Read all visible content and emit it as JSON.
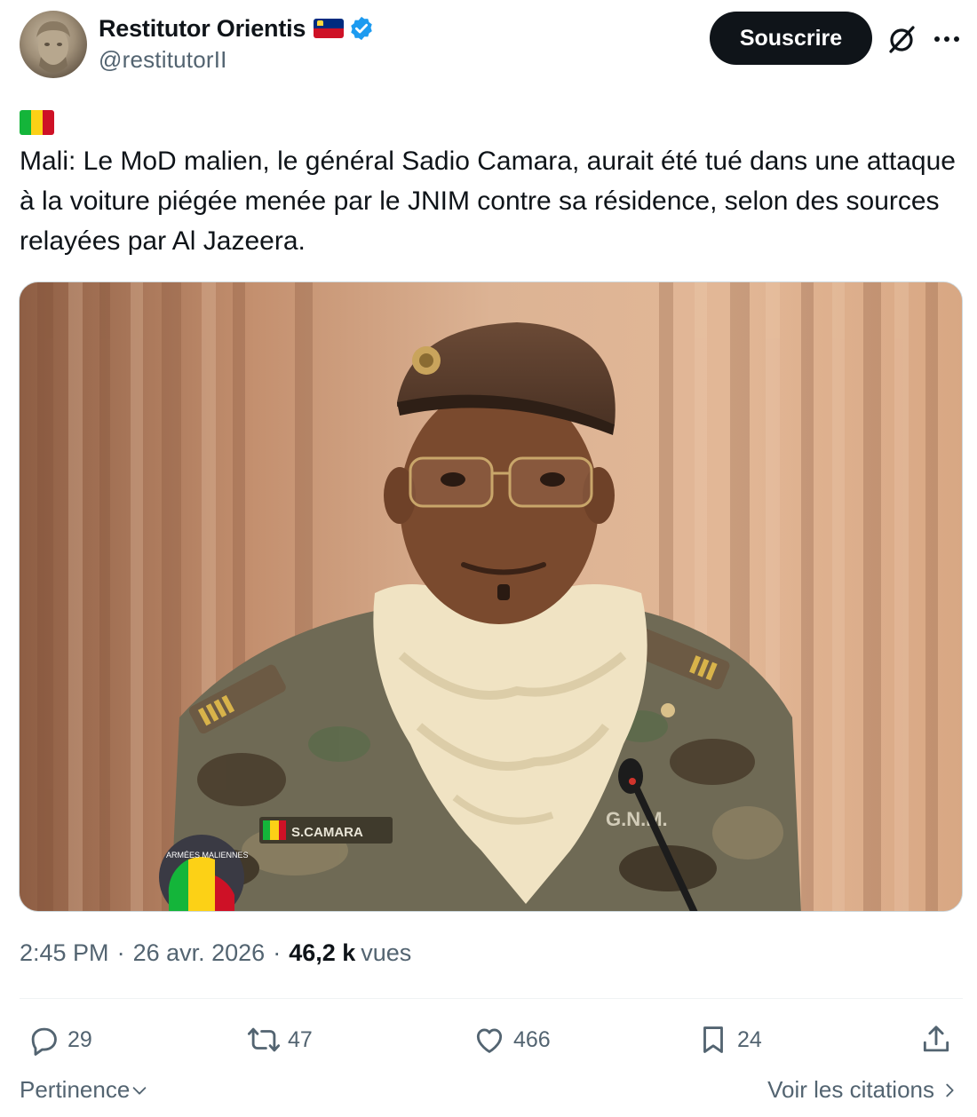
{
  "author": {
    "display_name": "Restitutor Orientis",
    "handle": "@restitutorII",
    "flag_icon": "liechtenstein-flag-icon",
    "verified_icon": "verified-badge-icon",
    "verified_color": "#1d9bf0"
  },
  "header": {
    "subscribe_label": "Souscrire",
    "grok_icon": "grok-icon",
    "more_icon": "more-icon"
  },
  "tweet": {
    "flag_icon": "mali-flag-icon",
    "text": "Mali: Le MoD malien, le général Sadio Camara, aurait été tué dans une attaque à la voiture piégée menée par le JNIM contre sa résidence, selon des sources relayées par Al Jazeera.",
    "media_name_tag": "S.CAMARA",
    "media_chest_text": "G.N.M.",
    "media_patch_text": "ARMÉES MALIENNES"
  },
  "meta": {
    "time": "2:45 PM",
    "date": "26 avr. 2026",
    "views_count": "46,2 k",
    "views_label": "vues",
    "separator": "·"
  },
  "actions": {
    "replies": "29",
    "reposts": "47",
    "likes": "466",
    "bookmarks": "24"
  },
  "footer": {
    "sort_label": "Pertinence",
    "quotes_label": "Voir les citations"
  },
  "colors": {
    "text_primary": "#0f1419",
    "text_secondary": "#536471",
    "divider": "#eff3f4",
    "button_bg": "#0f1419",
    "mali_green": "#14b53a",
    "mali_yellow": "#fcd116",
    "mali_red": "#ce1126"
  }
}
